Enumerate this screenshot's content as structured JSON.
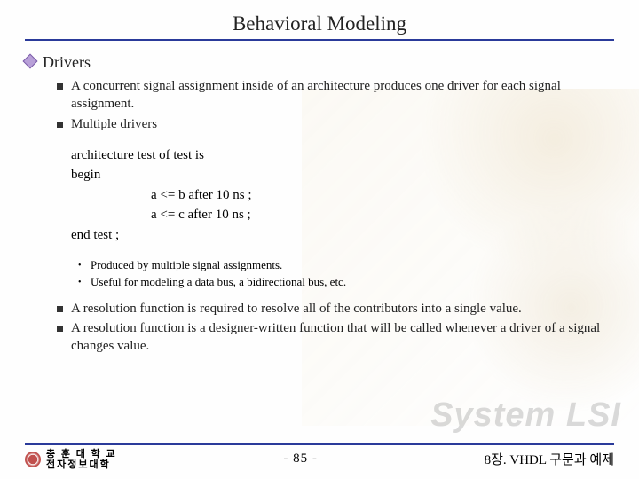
{
  "title": "Behavioral Modeling",
  "section": "Drivers",
  "bullets_top": [
    "A concurrent signal assignment inside of an architecture produces one driver for each signal assignment.",
    "Multiple drivers"
  ],
  "code": {
    "l1": "architecture test of test is",
    "l2": "begin",
    "l3": "a <= b  after 10  ns ;",
    "l4": "a <= c  after 10  ns ;",
    "l5": "end test ;"
  },
  "sub_bullets": [
    "Produced by multiple signal assignments.",
    "Useful for modeling a data bus, a bidirectional bus, etc."
  ],
  "bullets_bottom": [
    "A resolution function is required to resolve all of the contributors into a single value.",
    "A resolution function is a designer-written function that will be called whenever a driver of a signal changes value."
  ],
  "footer": {
    "uni1": "충 훈 대 학 교",
    "uni2": "전자정보대학",
    "page": "-  85  -",
    "chapter": "8장. VHDL 구문과 예제"
  },
  "watermark": "System LSI"
}
